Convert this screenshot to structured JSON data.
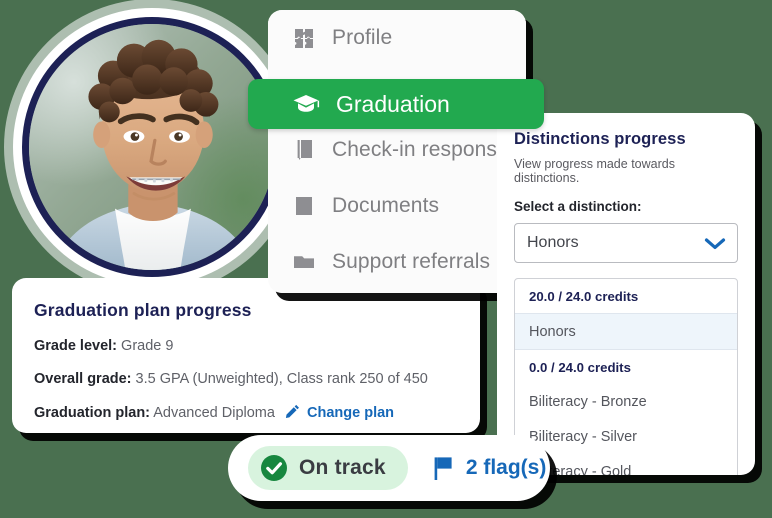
{
  "theme": {
    "background": "#4a7050",
    "accent_green": "#22a94f",
    "accent_blue": "#1668b8",
    "navy": "#1d2155",
    "pill_green_bg": "#d8f3de",
    "highlight_row_bg": "#eef5fb"
  },
  "avatar": {
    "name": "student-avatar",
    "description": "Smiling teenage student with curly hair and braces",
    "ring_color": "#1d2155"
  },
  "menu": {
    "items": [
      {
        "label": "Profile",
        "icon": "puzzle-piece-icon",
        "active": false
      },
      {
        "label": "Check-in responses",
        "icon": "book-pencil-icon",
        "active": false
      },
      {
        "label": "Documents",
        "icon": "book-bookmark-icon",
        "active": false
      },
      {
        "label": "Support referrals",
        "icon": "folder-icon",
        "active": false
      }
    ],
    "active_item": {
      "label": "Graduation",
      "icon": "graduation-cap-icon",
      "active": true
    }
  },
  "distinctions": {
    "title": "Distinctions progress",
    "subtitle": "View progress made towards distinctions.",
    "select_label": "Select a distinction:",
    "select_value": "Honors",
    "select_icon": "chevron-down-icon",
    "rows": [
      {
        "type": "credits",
        "text": "20.0 / 24.0 credits"
      },
      {
        "type": "option",
        "text": "Honors",
        "selected": true
      },
      {
        "type": "credits",
        "text": "0.0 / 24.0 credits"
      },
      {
        "type": "option",
        "text": "Biliteracy - Bronze",
        "selected": false
      },
      {
        "type": "option",
        "text": "Biliteracy - Silver",
        "selected": false
      },
      {
        "type": "option",
        "text": "Biliteracy - Gold",
        "selected": false
      }
    ]
  },
  "plan": {
    "title": "Graduation plan progress",
    "grade_level_label": "Grade level:",
    "grade_level_value": "Grade 9",
    "overall_grade_label": "Overall grade:",
    "overall_grade_value": "3.5 GPA (Unweighted), Class rank 250 of 450",
    "graduation_plan_label": "Graduation plan:",
    "graduation_plan_value": "Advanced Diploma",
    "change_plan_link": "Change plan",
    "change_plan_icon": "pencil-icon"
  },
  "status": {
    "on_track_label": "On track",
    "on_track_icon": "check-circle-icon",
    "flags_label": "2 flag(s)",
    "flags_icon": "flag-icon"
  }
}
